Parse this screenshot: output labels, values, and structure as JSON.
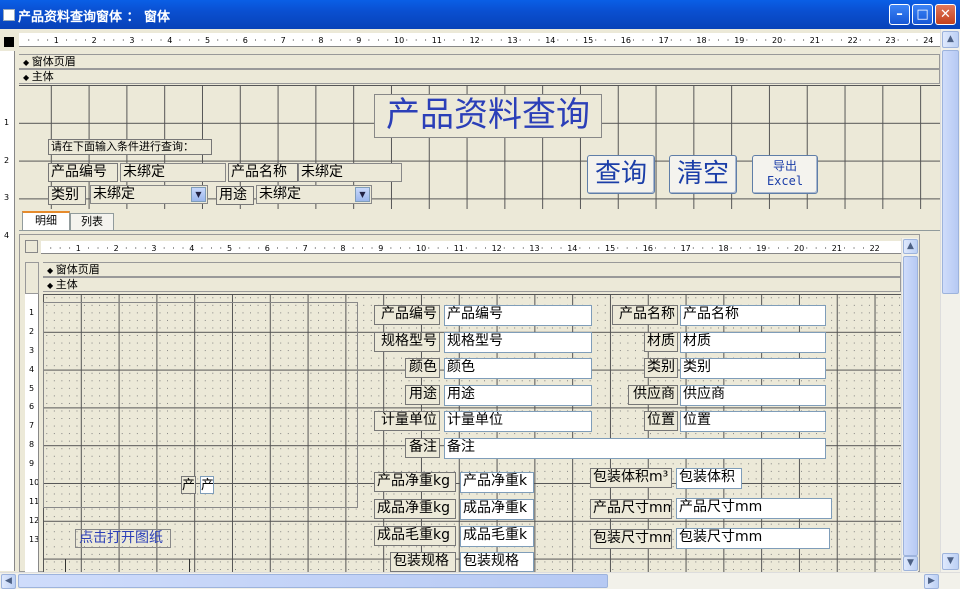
{
  "window": {
    "title": "产品资料查询窗体 ： 窗体"
  },
  "outer": {
    "section_header": "窗体页眉",
    "section_detail": "主体",
    "ruler_ticks": [
      "1",
      "2",
      "3",
      "4",
      "5",
      "6",
      "7",
      "8",
      "9",
      "10",
      "11",
      "12",
      "13",
      "14",
      "15",
      "16",
      "17",
      "18",
      "19",
      "20",
      "21",
      "22",
      "23",
      "24"
    ],
    "vruler_ticks": [
      "1",
      "2",
      "3",
      "4"
    ],
    "heading": "产品资料查询",
    "prompt": "请在下面输入条件进行查询：",
    "filters": {
      "product_no_label": "产品编号",
      "product_no_value": "未绑定",
      "product_name_label": "产品名称",
      "product_name_value": "未绑定",
      "category_label": "类别",
      "category_value": "未绑定",
      "usage_label": "用途",
      "usage_value": "未绑定"
    },
    "buttons": {
      "query": "查询",
      "clear": "清空",
      "export_line1": "导出",
      "export_line2": "Excel"
    }
  },
  "tabs": [
    {
      "label": "明细"
    },
    {
      "label": "列表"
    }
  ],
  "subform": {
    "section_header": "窗体页眉",
    "section_detail": "主体",
    "ruler_ticks": [
      "1",
      "2",
      "3",
      "4",
      "5",
      "6",
      "7",
      "8",
      "9",
      "10",
      "11",
      "12",
      "13",
      "14",
      "15",
      "16",
      "17",
      "18",
      "19",
      "20",
      "21",
      "22"
    ],
    "vruler_ticks": [
      "1",
      "2",
      "3",
      "4",
      "5",
      "6",
      "7",
      "8",
      "9",
      "10",
      "11",
      "12",
      "13"
    ],
    "image_label": "产",
    "image_value": "产",
    "open_drawing": "点击打开图纸",
    "fields": {
      "product_no": {
        "label": "产品编号",
        "value": "产品编号"
      },
      "product_name": {
        "label": "产品名称",
        "value": "产品名称"
      },
      "spec_model": {
        "label": "规格型号",
        "value": "规格型号"
      },
      "material": {
        "label": "材质",
        "value": "材质"
      },
      "color": {
        "label": "颜色",
        "value": "颜色"
      },
      "category": {
        "label": "类别",
        "value": "类别"
      },
      "usage": {
        "label": "用途",
        "value": "用途"
      },
      "supplier": {
        "label": "供应商",
        "value": "供应商"
      },
      "unit": {
        "label": "计量单位",
        "value": "计量单位"
      },
      "location": {
        "label": "位置",
        "value": "位置"
      },
      "remark": {
        "label": "备注",
        "value": "备注"
      },
      "prod_net_weight": {
        "label": "产品净重kg",
        "value": "产品净重k"
      },
      "pack_volume": {
        "label": "包装体积m³",
        "value": "包装体积"
      },
      "finished_net_weight": {
        "label": "成品净重kg",
        "value": "成品净重k"
      },
      "prod_size": {
        "label": "产品尺寸mm",
        "value": "产品尺寸mm"
      },
      "finished_gross_weight": {
        "label": "成品毛重kg",
        "value": "成品毛重k"
      },
      "pack_size": {
        "label": "包装尺寸mm",
        "value": "包装尺寸mm"
      },
      "pack_spec": {
        "label": "包装规格",
        "value": "包装规格"
      }
    }
  }
}
